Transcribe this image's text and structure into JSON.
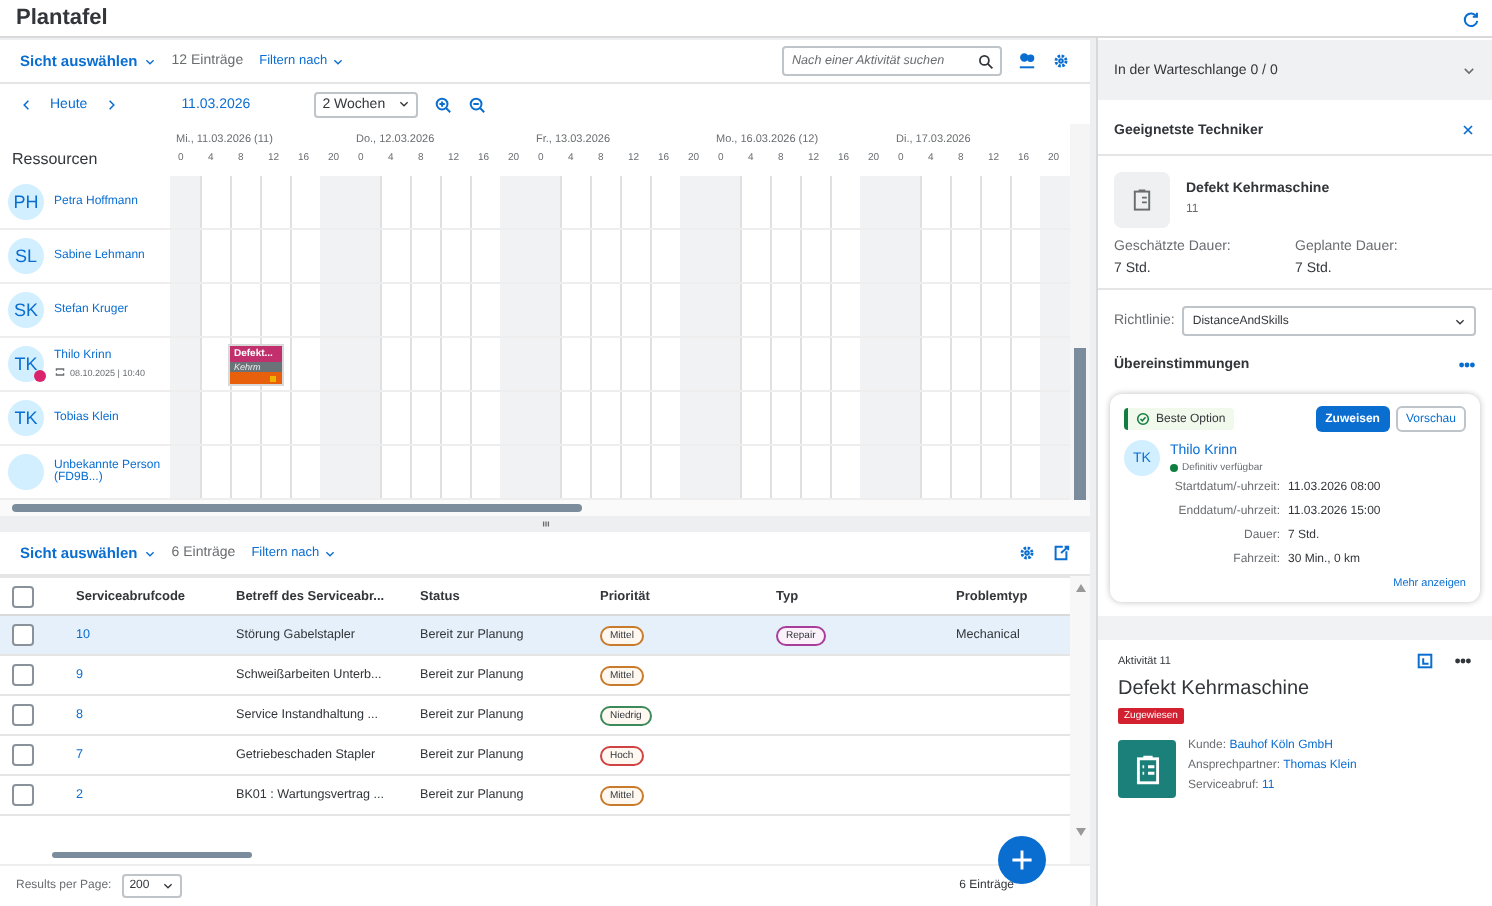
{
  "header": {
    "title": "Plantafel"
  },
  "gantt": {
    "toolbar": {
      "view": "Sicht auswählen",
      "count": "12 Einträge",
      "filter": "Filtern nach",
      "search_placeholder": "Nach einer Aktivität suchen"
    },
    "nav": {
      "today": "Heute",
      "date": "11.03.2026",
      "range": "2 Wochen"
    },
    "resources_label": "Ressourcen",
    "days": [
      {
        "label": "Mi., 11.03.2026 (11)",
        "ticks": [
          "0",
          "4",
          "8",
          "12",
          "16",
          "20"
        ]
      },
      {
        "label": "Do., 12.03.2026",
        "ticks": [
          "0",
          "4",
          "8",
          "12",
          "16",
          "20"
        ]
      },
      {
        "label": "Fr., 13.03.2026",
        "ticks": [
          "0",
          "4",
          "8",
          "12",
          "16",
          "20"
        ]
      },
      {
        "label": "Mo., 16.03.2026 (12)",
        "ticks": [
          "0",
          "4",
          "8",
          "12",
          "16",
          "20"
        ]
      },
      {
        "label": "Di., 17.03.2026",
        "ticks": [
          "0",
          "4",
          "8",
          "12",
          "16",
          "20"
        ]
      }
    ],
    "resources": [
      {
        "initials": "PH",
        "name": "Petra Hoffmann"
      },
      {
        "initials": "SL",
        "name": "Sabine Lehmann"
      },
      {
        "initials": "SK",
        "name": "Stefan Kruger"
      },
      {
        "initials": "TK",
        "name": "Thilo Krinn",
        "alert": true,
        "sync": "08.10.2025 | 10:40",
        "tasks": [
          {
            "title": "Defekt...",
            "subtitle": "Kehrm"
          }
        ]
      },
      {
        "initials": "TK",
        "name": "Tobias Klein"
      },
      {
        "name": "Unbekannte Person (FD9B...)"
      }
    ]
  },
  "table": {
    "toolbar": {
      "view": "Sicht auswählen",
      "count": "6 Einträge",
      "filter": "Filtern nach"
    },
    "all_checked": false,
    "columns": [
      "Serviceabrufcode",
      "Betreff des Serviceabr...",
      "Status",
      "Priorität",
      "Typ",
      "Problemtyp"
    ],
    "rows": [
      {
        "selected": true,
        "checked": false,
        "code": "10",
        "subject": "Störung Gabelstapler",
        "status": "Bereit zur Planung",
        "priority": {
          "label": "Mittel",
          "color": "#c87b2a"
        },
        "type": {
          "label": "Repair",
          "color": "#a93e9a"
        },
        "problem": "Mechanical"
      },
      {
        "selected": false,
        "checked": false,
        "code": "9",
        "subject": "Schweißarbeiten Unterb...",
        "status": "Bereit zur Planung",
        "priority": {
          "label": "Mittel",
          "color": "#c87b2a"
        }
      },
      {
        "selected": false,
        "checked": false,
        "code": "8",
        "subject": "Service Instandhaltung ...",
        "status": "Bereit zur Planung",
        "priority": {
          "label": "Niedrig",
          "color": "#3c8a5a"
        }
      },
      {
        "selected": false,
        "checked": false,
        "code": "7",
        "subject": "Getriebeschaden Stapler",
        "status": "Bereit zur Planung",
        "priority": {
          "label": "Hoch",
          "color": "#d04343"
        }
      },
      {
        "selected": false,
        "checked": false,
        "code": "2",
        "subject": "BK01 : Wartungsvertrag ...",
        "status": "Bereit zur Planung",
        "priority": {
          "label": "Mittel",
          "color": "#c87b2a"
        }
      }
    ],
    "footer": {
      "label": "Results per Page:",
      "page_size": "200",
      "count": "6 Einträge"
    }
  },
  "queue": {
    "title": "In der Warteschlange 0 / 0",
    "expanded": false
  },
  "technicians": {
    "title": "Geeignetste Techniker",
    "activity": {
      "title": "Defekt Kehrmaschine",
      "id": "11"
    },
    "durations": [
      {
        "label": "Geschätzte Dauer:",
        "value": "7 Std."
      },
      {
        "label": "Geplante Dauer:",
        "value": "7 Std."
      }
    ],
    "policy": {
      "label": "Richtlinie:",
      "value": "DistanceAndSkills"
    },
    "matches_title": "Übereinstimmungen",
    "matches": [
      {
        "badge": "Beste Option",
        "assign": "Zuweisen",
        "preview": "Vorschau",
        "initials": "TK",
        "name": "Thilo Krinn",
        "availability": "Definitiv verfügbar",
        "available": true,
        "details": [
          {
            "label": "Startdatum/-uhrzeit:",
            "value": "11.03.2026 08:00"
          },
          {
            "label": "Enddatum/-uhrzeit:",
            "value": "11.03.2026 15:00"
          },
          {
            "label": "Dauer:",
            "value": "7 Std."
          },
          {
            "label": "Fahrzeit:",
            "value": "30 Min., 0 km"
          }
        ],
        "more": "Mehr anzeigen"
      }
    ]
  },
  "activity": {
    "label": "Aktivität 11",
    "title": "Defekt Kehrmaschine",
    "status": "Zugewiesen",
    "fields": [
      {
        "label": "Kunde:",
        "value": "Bauhof Köln GmbH"
      },
      {
        "label": "Ansprechpartner:",
        "value": "Thomas Klein"
      },
      {
        "label": "Serviceabruf:",
        "value": "11"
      }
    ]
  }
}
